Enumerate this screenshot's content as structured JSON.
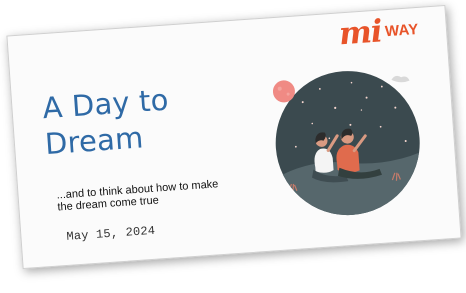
{
  "slide": {
    "title": "A Day to Dream",
    "subtitle": "...and to think about how to make the dream come true",
    "date": "May 15, 2024"
  },
  "logo": {
    "mi": "mi",
    "way": "WAY",
    "color": "#e8542a"
  },
  "illustration": {
    "icon": "stargazing-couple-illustration"
  },
  "colors": {
    "title": "#2f6aa6",
    "night_sky": "#3b4a4f",
    "moon": "#f08a84"
  }
}
